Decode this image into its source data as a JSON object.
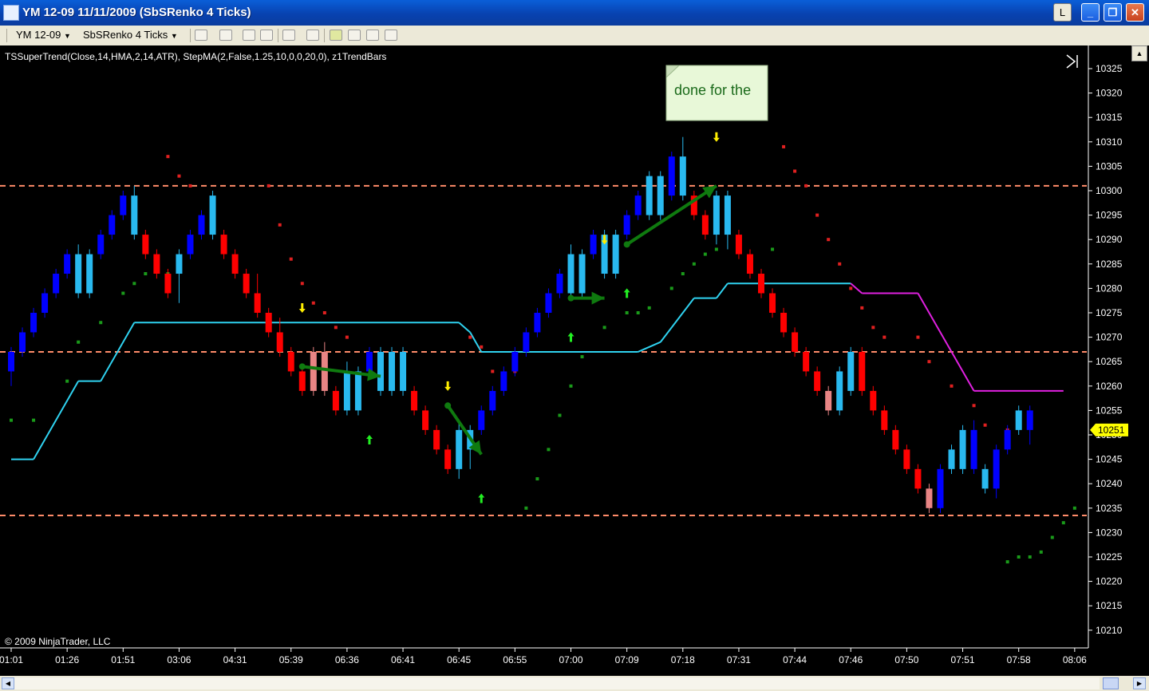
{
  "window": {
    "title": "YM 12-09  11/11/2009 (SbSRenko 4 Ticks)",
    "btn_l": "L"
  },
  "toolbar": {
    "instrument": "YM 12-09",
    "chart_type": "SbSRenko 4 Ticks"
  },
  "chart_data": {
    "type": "candlestick",
    "indicators_label": "TSSuperTrend(Close,14,HMA,2,14,ATR),  StepMA(2,False,1.25,10,0,0,20,0),  z1TrendBars",
    "copyright": "© 2009 NinjaTrader, LLC",
    "annotation": "done for the",
    "ylim": [
      10205,
      10327
    ],
    "y_ticks": [
      10325,
      10320,
      10315,
      10310,
      10305,
      10300,
      10295,
      10290,
      10285,
      10280,
      10275,
      10270,
      10265,
      10260,
      10255,
      10250,
      10245,
      10240,
      10235,
      10230,
      10225,
      10220,
      10215,
      10210
    ],
    "x_labels": [
      "01:01",
      "01:26",
      "01:51",
      "03:06",
      "04:31",
      "05:39",
      "06:36",
      "06:41",
      "06:45",
      "06:55",
      "07:00",
      "07:09",
      "07:18",
      "07:31",
      "07:44",
      "07:46",
      "07:50",
      "07:51",
      "07:58",
      "08:06"
    ],
    "last_price": "10251",
    "hlines": [
      10301,
      10267,
      10233.5
    ],
    "colors": {
      "up_strong": "#0000ff",
      "up_weak": "#29b9ef",
      "down_strong": "#ff0000",
      "down_weak": "#e88484",
      "supertrend_up": "#2fd2f0",
      "supertrend_down": "#e020e0",
      "dots_up": "#1a9a1a",
      "dots_down": "#e02020",
      "hline": "#ff8c6a",
      "annotation_bg": "#e8f8d8",
      "price_marker": "#ffff00"
    },
    "bars": [
      {
        "o": 10263,
        "c": 10267,
        "h": 10268,
        "l": 10260
      },
      {
        "o": 10267,
        "c": 10271,
        "h": 10272,
        "l": 10266
      },
      {
        "o": 10271,
        "c": 10275,
        "h": 10276,
        "l": 10270
      },
      {
        "o": 10275,
        "c": 10279,
        "h": 10280,
        "l": 10274
      },
      {
        "o": 10279,
        "c": 10283,
        "h": 10284,
        "l": 10278
      },
      {
        "o": 10283,
        "c": 10287,
        "h": 10288,
        "l": 10282
      },
      {
        "o": 10279,
        "c": 10287,
        "h": 10289,
        "l": 10278
      },
      {
        "o": 10279,
        "c": 10287,
        "h": 10288,
        "l": 10278
      },
      {
        "o": 10287,
        "c": 10291,
        "h": 10292,
        "l": 10286
      },
      {
        "o": 10291,
        "c": 10295,
        "h": 10296,
        "l": 10290
      },
      {
        "o": 10295,
        "c": 10299,
        "h": 10300,
        "l": 10294
      },
      {
        "o": 10291,
        "c": 10299,
        "h": 10301,
        "l": 10290
      },
      {
        "o": 10291,
        "c": 10287,
        "h": 10292,
        "l": 10286
      },
      {
        "o": 10287,
        "c": 10283,
        "h": 10288,
        "l": 10282
      },
      {
        "o": 10283,
        "c": 10279,
        "h": 10284,
        "l": 10278
      },
      {
        "o": 10283,
        "c": 10287,
        "h": 10288,
        "l": 10277
      },
      {
        "o": 10287,
        "c": 10291,
        "h": 10292,
        "l": 10286
      },
      {
        "o": 10291,
        "c": 10295,
        "h": 10296,
        "l": 10290
      },
      {
        "o": 10291,
        "c": 10299,
        "h": 10300,
        "l": 10290
      },
      {
        "o": 10291,
        "c": 10287,
        "h": 10292,
        "l": 10286
      },
      {
        "o": 10287,
        "c": 10283,
        "h": 10288,
        "l": 10282
      },
      {
        "o": 10283,
        "c": 10279,
        "h": 10284,
        "l": 10278
      },
      {
        "o": 10279,
        "c": 10275,
        "h": 10283,
        "l": 10274
      },
      {
        "o": 10275,
        "c": 10271,
        "h": 10276,
        "l": 10270
      },
      {
        "o": 10271,
        "c": 10267,
        "h": 10274,
        "l": 10266
      },
      {
        "o": 10267,
        "c": 10263,
        "h": 10268,
        "l": 10262
      },
      {
        "o": 10263,
        "c": 10259,
        "h": 10264,
        "l": 10258
      },
      {
        "o": 10267,
        "c": 10259,
        "h": 10268,
        "l": 10258
      },
      {
        "o": 10267,
        "c": 10259,
        "h": 10269,
        "l": 10258
      },
      {
        "o": 10259,
        "c": 10255,
        "h": 10260,
        "l": 10254
      },
      {
        "o": 10255,
        "c": 10263,
        "h": 10265,
        "l": 10254
      },
      {
        "o": 10255,
        "c": 10263,
        "h": 10264,
        "l": 10254
      },
      {
        "o": 10263,
        "c": 10267,
        "h": 10268,
        "l": 10262
      },
      {
        "o": 10259,
        "c": 10267,
        "h": 10268,
        "l": 10258
      },
      {
        "o": 10259,
        "c": 10267,
        "h": 10268,
        "l": 10258
      },
      {
        "o": 10259,
        "c": 10267,
        "h": 10268,
        "l": 10258
      },
      {
        "o": 10259,
        "c": 10255,
        "h": 10260,
        "l": 10254
      },
      {
        "o": 10255,
        "c": 10251,
        "h": 10256,
        "l": 10250
      },
      {
        "o": 10251,
        "c": 10247,
        "h": 10252,
        "l": 10246
      },
      {
        "o": 10247,
        "c": 10243,
        "h": 10248,
        "l": 10242
      },
      {
        "o": 10243,
        "c": 10251,
        "h": 10253,
        "l": 10241
      },
      {
        "o": 10247,
        "c": 10251,
        "h": 10252,
        "l": 10243
      },
      {
        "o": 10251,
        "c": 10255,
        "h": 10256,
        "l": 10250
      },
      {
        "o": 10255,
        "c": 10259,
        "h": 10260,
        "l": 10254
      },
      {
        "o": 10259,
        "c": 10263,
        "h": 10264,
        "l": 10258
      },
      {
        "o": 10263,
        "c": 10267,
        "h": 10268,
        "l": 10262
      },
      {
        "o": 10267,
        "c": 10271,
        "h": 10272,
        "l": 10266
      },
      {
        "o": 10271,
        "c": 10275,
        "h": 10276,
        "l": 10270
      },
      {
        "o": 10275,
        "c": 10279,
        "h": 10280,
        "l": 10274
      },
      {
        "o": 10279,
        "c": 10283,
        "h": 10284,
        "l": 10278
      },
      {
        "o": 10279,
        "c": 10287,
        "h": 10289,
        "l": 10278
      },
      {
        "o": 10279,
        "c": 10287,
        "h": 10288,
        "l": 10278
      },
      {
        "o": 10287,
        "c": 10291,
        "h": 10292,
        "l": 10286
      },
      {
        "o": 10283,
        "c": 10291,
        "h": 10292,
        "l": 10282
      },
      {
        "o": 10283,
        "c": 10291,
        "h": 10292,
        "l": 10282
      },
      {
        "o": 10291,
        "c": 10295,
        "h": 10296,
        "l": 10290
      },
      {
        "o": 10295,
        "c": 10299,
        "h": 10300,
        "l": 10294
      },
      {
        "o": 10295,
        "c": 10303,
        "h": 10304,
        "l": 10294
      },
      {
        "o": 10295,
        "c": 10303,
        "h": 10304,
        "l": 10294
      },
      {
        "o": 10299,
        "c": 10307,
        "h": 10308,
        "l": 10298
      },
      {
        "o": 10299,
        "c": 10307,
        "h": 10311,
        "l": 10298
      },
      {
        "o": 10299,
        "c": 10295,
        "h": 10300,
        "l": 10294
      },
      {
        "o": 10295,
        "c": 10291,
        "h": 10296,
        "l": 10290
      },
      {
        "o": 10291,
        "c": 10299,
        "h": 10300,
        "l": 10289
      },
      {
        "o": 10291,
        "c": 10299,
        "h": 10300,
        "l": 10288
      },
      {
        "o": 10291,
        "c": 10287,
        "h": 10292,
        "l": 10286
      },
      {
        "o": 10287,
        "c": 10283,
        "h": 10288,
        "l": 10282
      },
      {
        "o": 10283,
        "c": 10279,
        "h": 10284,
        "l": 10278
      },
      {
        "o": 10279,
        "c": 10275,
        "h": 10280,
        "l": 10274
      },
      {
        "o": 10275,
        "c": 10271,
        "h": 10276,
        "l": 10270
      },
      {
        "o": 10271,
        "c": 10267,
        "h": 10272,
        "l": 10266
      },
      {
        "o": 10267,
        "c": 10263,
        "h": 10268,
        "l": 10262
      },
      {
        "o": 10263,
        "c": 10259,
        "h": 10264,
        "l": 10258
      },
      {
        "o": 10259,
        "c": 10255,
        "h": 10260,
        "l": 10254
      },
      {
        "o": 10255,
        "c": 10263,
        "h": 10264,
        "l": 10254
      },
      {
        "o": 10259,
        "c": 10267,
        "h": 10268,
        "l": 10258
      },
      {
        "o": 10267,
        "c": 10259,
        "h": 10268,
        "l": 10258
      },
      {
        "o": 10259,
        "c": 10255,
        "h": 10260,
        "l": 10254
      },
      {
        "o": 10255,
        "c": 10251,
        "h": 10256,
        "l": 10250
      },
      {
        "o": 10251,
        "c": 10247,
        "h": 10252,
        "l": 10246
      },
      {
        "o": 10247,
        "c": 10243,
        "h": 10248,
        "l": 10242
      },
      {
        "o": 10243,
        "c": 10239,
        "h": 10244,
        "l": 10238
      },
      {
        "o": 10239,
        "c": 10235,
        "h": 10240,
        "l": 10234
      },
      {
        "o": 10235,
        "c": 10243,
        "h": 10244,
        "l": 10234
      },
      {
        "o": 10243,
        "c": 10247,
        "h": 10248,
        "l": 10242
      },
      {
        "o": 10243,
        "c": 10251,
        "h": 10252,
        "l": 10242
      },
      {
        "o": 10243,
        "c": 10251,
        "h": 10253,
        "l": 10242
      },
      {
        "o": 10239,
        "c": 10243,
        "h": 10244,
        "l": 10238
      },
      {
        "o": 10239,
        "c": 10247,
        "h": 10248,
        "l": 10237
      },
      {
        "o": 10247,
        "c": 10251,
        "h": 10252,
        "l": 10246
      },
      {
        "o": 10251,
        "c": 10255,
        "h": 10256,
        "l": 10250
      },
      {
        "o": 10251,
        "c": 10255,
        "h": 10256,
        "l": 10248
      }
    ],
    "bar_styles": [
      "s",
      "s",
      "s",
      "s",
      "s",
      "s",
      "w",
      "w",
      "s",
      "s",
      "s",
      "w",
      "s",
      "s",
      "s",
      "w",
      "s",
      "s",
      "w",
      "s",
      "s",
      "s",
      "s",
      "s",
      "s",
      "s",
      "s",
      "w",
      "w",
      "s",
      "w",
      "w",
      "s",
      "w",
      "w",
      "w",
      "s",
      "s",
      "s",
      "s",
      "w",
      "w",
      "s",
      "s",
      "s",
      "s",
      "s",
      "s",
      "s",
      "s",
      "w",
      "w",
      "s",
      "w",
      "w",
      "s",
      "s",
      "w",
      "w",
      "s",
      "w",
      "s",
      "s",
      "w",
      "w",
      "s",
      "s",
      "s",
      "s",
      "s",
      "s",
      "s",
      "s",
      "w",
      "w",
      "w",
      "s",
      "s",
      "s",
      "s",
      "s",
      "s",
      "w",
      "s",
      "w",
      "w",
      "s",
      "w",
      "s",
      "s",
      "w"
    ],
    "supertrend": [
      {
        "i": 0,
        "v": 10245
      },
      {
        "i": 2,
        "v": 10245
      },
      {
        "i": 6,
        "v": 10261
      },
      {
        "i": 8,
        "v": 10261
      },
      {
        "i": 11,
        "v": 10273
      },
      {
        "i": 40,
        "v": 10273
      },
      {
        "i": 41,
        "v": 10271
      },
      {
        "i": 42,
        "v": 10267
      },
      {
        "i": 56,
        "v": 10267
      },
      {
        "i": 58,
        "v": 10269
      },
      {
        "i": 61,
        "v": 10278
      },
      {
        "i": 63,
        "v": 10278
      },
      {
        "i": 64,
        "v": 10281
      },
      {
        "i": 75,
        "v": 10281
      },
      {
        "i": 76,
        "v": 10279
      },
      {
        "i": 81,
        "v": 10279
      },
      {
        "i": 86,
        "v": 10259
      },
      {
        "i": 94,
        "v": 10259
      }
    ],
    "stepdots_up": [
      {
        "i": 0,
        "v": 10253
      },
      {
        "i": 2,
        "v": 10253
      },
      {
        "i": 5,
        "v": 10261
      },
      {
        "i": 6,
        "v": 10269
      },
      {
        "i": 8,
        "v": 10273
      },
      {
        "i": 10,
        "v": 10279
      },
      {
        "i": 11,
        "v": 10281
      },
      {
        "i": 12,
        "v": 10283
      },
      {
        "i": 14,
        "v": 10283
      },
      {
        "i": 46,
        "v": 10235
      },
      {
        "i": 47,
        "v": 10241
      },
      {
        "i": 48,
        "v": 10247
      },
      {
        "i": 49,
        "v": 10254
      },
      {
        "i": 50,
        "v": 10260
      },
      {
        "i": 51,
        "v": 10266
      },
      {
        "i": 53,
        "v": 10272
      },
      {
        "i": 55,
        "v": 10275
      },
      {
        "i": 56,
        "v": 10275
      },
      {
        "i": 57,
        "v": 10276
      },
      {
        "i": 59,
        "v": 10280
      },
      {
        "i": 60,
        "v": 10283
      },
      {
        "i": 61,
        "v": 10285
      },
      {
        "i": 62,
        "v": 10287
      },
      {
        "i": 63,
        "v": 10288
      },
      {
        "i": 68,
        "v": 10288
      },
      {
        "i": 89,
        "v": 10224
      },
      {
        "i": 90,
        "v": 10225
      },
      {
        "i": 91,
        "v": 10225
      },
      {
        "i": 92,
        "v": 10226
      },
      {
        "i": 93,
        "v": 10229
      },
      {
        "i": 94,
        "v": 10232
      },
      {
        "i": 95,
        "v": 10235
      }
    ],
    "stepdots_down": [
      {
        "i": 14,
        "v": 10307
      },
      {
        "i": 15,
        "v": 10303
      },
      {
        "i": 16,
        "v": 10301
      },
      {
        "i": 23,
        "v": 10301
      },
      {
        "i": 24,
        "v": 10293
      },
      {
        "i": 25,
        "v": 10286
      },
      {
        "i": 26,
        "v": 10281
      },
      {
        "i": 27,
        "v": 10277
      },
      {
        "i": 28,
        "v": 10275
      },
      {
        "i": 29,
        "v": 10272
      },
      {
        "i": 30,
        "v": 10270
      },
      {
        "i": 41,
        "v": 10270
      },
      {
        "i": 42,
        "v": 10268
      },
      {
        "i": 43,
        "v": 10263
      },
      {
        "i": 45,
        "v": 10263
      },
      {
        "i": 69,
        "v": 10309
      },
      {
        "i": 70,
        "v": 10304
      },
      {
        "i": 71,
        "v": 10301
      },
      {
        "i": 72,
        "v": 10295
      },
      {
        "i": 73,
        "v": 10290
      },
      {
        "i": 74,
        "v": 10285
      },
      {
        "i": 75,
        "v": 10280
      },
      {
        "i": 76,
        "v": 10276
      },
      {
        "i": 77,
        "v": 10272
      },
      {
        "i": 78,
        "v": 10270
      },
      {
        "i": 81,
        "v": 10270
      },
      {
        "i": 82,
        "v": 10265
      },
      {
        "i": 84,
        "v": 10260
      },
      {
        "i": 86,
        "v": 10256
      },
      {
        "i": 87,
        "v": 10252
      },
      {
        "i": 89,
        "v": 10251
      }
    ],
    "arrows": [
      {
        "type": "down",
        "i": 26,
        "v": 10275
      },
      {
        "type": "up",
        "i": 32,
        "v": 10250
      },
      {
        "type": "down",
        "i": 39,
        "v": 10259
      },
      {
        "type": "up",
        "i": 42,
        "v": 10238
      },
      {
        "type": "up",
        "i": 50,
        "v": 10271
      },
      {
        "type": "down",
        "i": 53,
        "v": 10289
      },
      {
        "type": "up",
        "i": 55,
        "v": 10280
      },
      {
        "type": "down",
        "i": 63,
        "v": 10310
      }
    ],
    "trend_arrows": [
      {
        "i1": 26,
        "v1": 10264,
        "i2": 33,
        "v2": 10262
      },
      {
        "i1": 39,
        "v1": 10256,
        "i2": 42,
        "v2": 10246
      },
      {
        "i1": 50,
        "v1": 10278,
        "i2": 53,
        "v2": 10278
      },
      {
        "i1": 55,
        "v1": 10289,
        "i2": 63,
        "v2": 10301
      }
    ],
    "x_label_bars": [
      0,
      5,
      10,
      15,
      20,
      25,
      30,
      35,
      40,
      45,
      50,
      55,
      60,
      65,
      70,
      75,
      80,
      85,
      90,
      95
    ]
  }
}
